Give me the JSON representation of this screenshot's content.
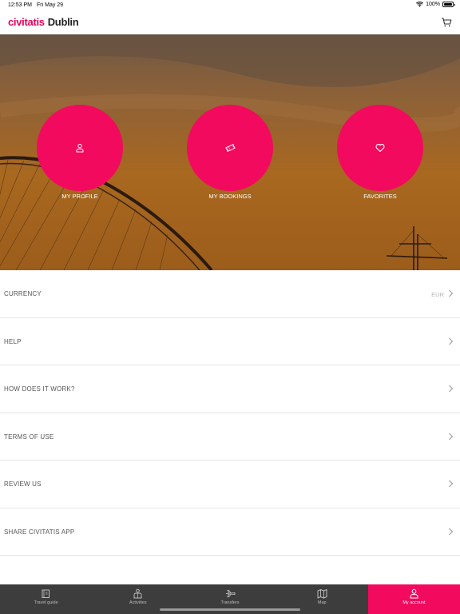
{
  "status_bar": {
    "time": "12:53 PM",
    "date": "Fri May 29",
    "battery": "100%",
    "battery_level": 1.0
  },
  "header": {
    "brand": "civitatis",
    "city": "Dublin"
  },
  "hero": {
    "buttons": [
      {
        "label": "MY PROFILE",
        "icon": "user-icon"
      },
      {
        "label": "MY BOOKINGS",
        "icon": "ticket-icon"
      },
      {
        "label": "FAVORITES",
        "icon": "heart-icon"
      }
    ]
  },
  "menu": {
    "items": [
      {
        "label": "CURRENCY",
        "value": "EUR"
      },
      {
        "label": "HELP",
        "value": ""
      },
      {
        "label": "HOW DOES IT WORK?",
        "value": ""
      },
      {
        "label": "TERMS OF USE",
        "value": ""
      },
      {
        "label": "REVIEW US",
        "value": ""
      },
      {
        "label": "SHARE CIVITATIS APP",
        "value": ""
      }
    ]
  },
  "tabbar": {
    "tabs": [
      {
        "label": "Travel guide",
        "icon": "guide-book-icon",
        "active": false
      },
      {
        "label": "Activities",
        "icon": "activities-icon",
        "active": false
      },
      {
        "label": "Transfers",
        "icon": "plane-icon",
        "active": false
      },
      {
        "label": "Map",
        "icon": "map-icon",
        "active": false
      },
      {
        "label": "My account",
        "icon": "user-icon",
        "active": true
      }
    ]
  },
  "colors": {
    "brand": "#e8005a",
    "accent": "#f20a5e",
    "tabbar": "#3d3d3d"
  }
}
